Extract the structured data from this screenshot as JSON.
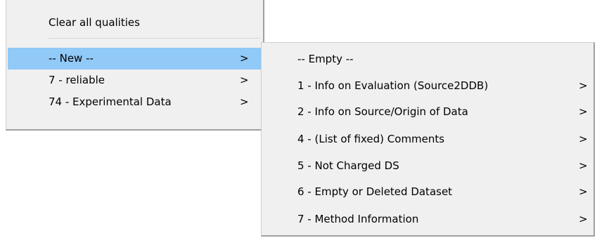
{
  "main_menu": {
    "items": [
      {
        "label": "Clear all qualities",
        "has_submenu": false
      },
      {
        "label": "-- New --",
        "has_submenu": true,
        "highlighted": true
      },
      {
        "label": "7 - reliable",
        "has_submenu": true
      },
      {
        "label": "74 - Experimental Data",
        "has_submenu": true
      }
    ]
  },
  "sub_menu": {
    "items": [
      {
        "label": "-- Empty --",
        "has_submenu": false
      },
      {
        "label": "1 - Info on Evaluation (Source2DDB)",
        "has_submenu": true
      },
      {
        "label": "2 - Info on Source/Origin of Data",
        "has_submenu": true
      },
      {
        "label": "4 - (List of fixed) Comments",
        "has_submenu": true
      },
      {
        "label": "5 - Not Charged DS",
        "has_submenu": true
      },
      {
        "label": "6 - Empty or Deleted Dataset",
        "has_submenu": true
      },
      {
        "label": "7 - Method Information",
        "has_submenu": true
      }
    ]
  },
  "icons": {
    "submenu_arrow": ">"
  },
  "colors": {
    "menu_background": "#f0f0f0",
    "highlight": "#91c9f7"
  }
}
